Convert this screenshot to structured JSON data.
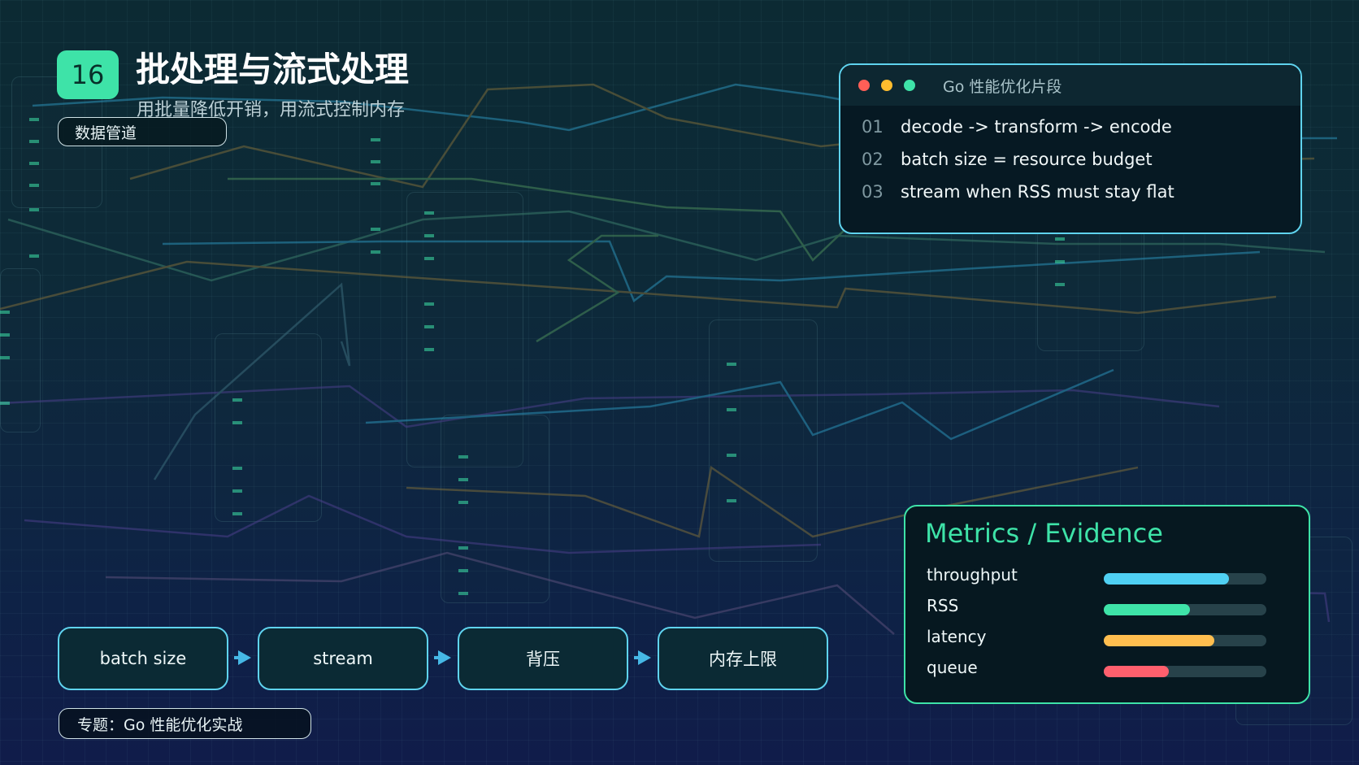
{
  "slide": {
    "number": "16",
    "title": "批处理与流式处理",
    "subtitle": "用批量降低开销，用流式控制内存",
    "tag": "数据管道",
    "topic": "专题：Go 性能优化实战"
  },
  "code_window": {
    "title": "Go 性能优化片段",
    "dot_colors": [
      "#ff5f57",
      "#ffbd2e",
      "#3ee3a8"
    ],
    "lines": [
      {
        "num": "01",
        "text": "decode -> transform -> encode"
      },
      {
        "num": "02",
        "text": "batch size = resource budget"
      },
      {
        "num": "03",
        "text": "stream when RSS must stay flat"
      }
    ]
  },
  "pipeline": [
    {
      "label": "batch size"
    },
    {
      "label": "stream"
    },
    {
      "label": "背压"
    },
    {
      "label": "内存上限"
    }
  ],
  "metrics": {
    "title": "Metrics / Evidence",
    "items": [
      {
        "label": "throughput",
        "level": 0.77,
        "color": "#4fd0f3"
      },
      {
        "label": "RSS",
        "level": 0.53,
        "color": "#3ee3a8"
      },
      {
        "label": "latency",
        "level": 0.68,
        "color": "#ffbe4f"
      },
      {
        "label": "queue",
        "level": 0.4,
        "color": "#ff5f6d"
      }
    ]
  },
  "colors": {
    "accent_green": "#3ee3a8",
    "accent_blue": "#5fd3ee",
    "background": "#0d2a38"
  }
}
